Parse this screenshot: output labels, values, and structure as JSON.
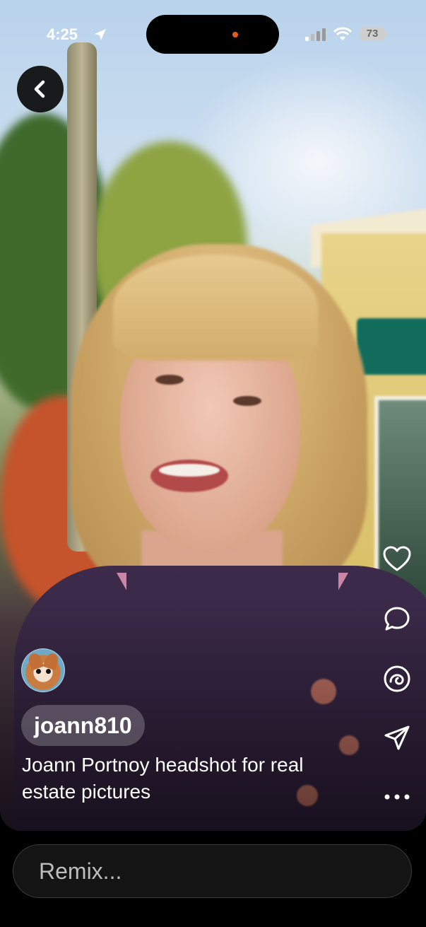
{
  "status_bar": {
    "time": "4:25",
    "battery": "73"
  },
  "post": {
    "username": "joann810",
    "caption": "Joann Portnoy headshot for real estate pictures"
  },
  "remix_input": {
    "placeholder": "Remix..."
  },
  "icons": {
    "back": "chevron-left-icon",
    "like": "heart-icon",
    "comment": "comment-bubble-icon",
    "remix": "remix-icon",
    "share": "paper-plane-icon",
    "more": "more-dots-icon"
  },
  "colors": {
    "background": "#000000",
    "collar_accent": "#c987a8",
    "recording_dot": "#e35b1f"
  }
}
